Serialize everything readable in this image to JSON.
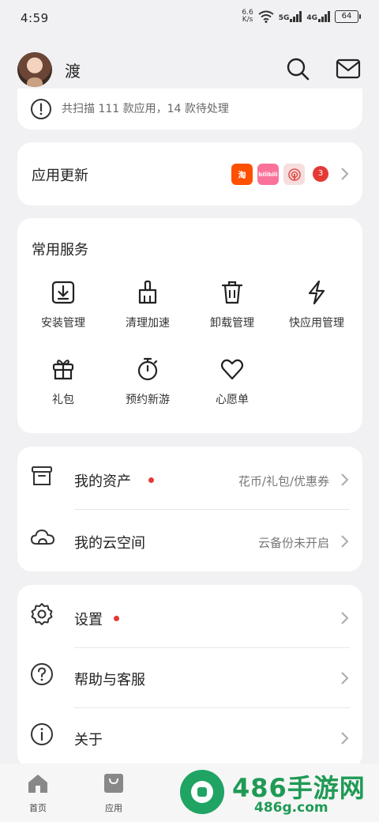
{
  "status_bar": {
    "time": "4:59",
    "net_speed_value": "6.6",
    "net_speed_unit": "K/s",
    "sim1": "5G",
    "sim2": "4G",
    "battery": "64"
  },
  "header": {
    "username": "渡"
  },
  "scan_notice": {
    "text": "共扫描 111 款应用，14 款待处理"
  },
  "app_update": {
    "title": "应用更新",
    "apps": [
      {
        "icon": "taobao-app-icon",
        "label": "淘",
        "color": "#ff5000"
      },
      {
        "icon": "bilibili-app-icon",
        "label": "bilibili",
        "color": "#fb7299"
      },
      {
        "icon": "podcast-app-icon",
        "label": "",
        "color": "#f3d6d6"
      }
    ],
    "count": "3"
  },
  "services": {
    "title": "常用服务",
    "items": [
      {
        "name": "install-manage",
        "label": "安装管理"
      },
      {
        "name": "clean-speedup",
        "label": "清理加速"
      },
      {
        "name": "uninstall-manage",
        "label": "卸载管理"
      },
      {
        "name": "quick-app-manage",
        "label": "快应用管理"
      },
      {
        "name": "gift-pack",
        "label": "礼包"
      },
      {
        "name": "reserve-new-games",
        "label": "预约新游"
      },
      {
        "name": "wishlist",
        "label": "心愿单"
      }
    ]
  },
  "assets": {
    "my_assets_label": "我的资产",
    "my_assets_value": "花币/礼包/优惠券",
    "cloud_space_label": "我的云空间",
    "cloud_space_value": "云备份未开启"
  },
  "settings": {
    "settings_label": "设置",
    "help_label": "帮助与客服",
    "about_label": "关于"
  },
  "bottom_nav": {
    "home": "首页",
    "apps": "应用"
  },
  "watermark": {
    "title": "486手游网",
    "url": "486g.com"
  },
  "colors": {
    "accent_red": "#e53935",
    "background": "#f1f1f3",
    "watermark_green": "#1f9a55"
  }
}
